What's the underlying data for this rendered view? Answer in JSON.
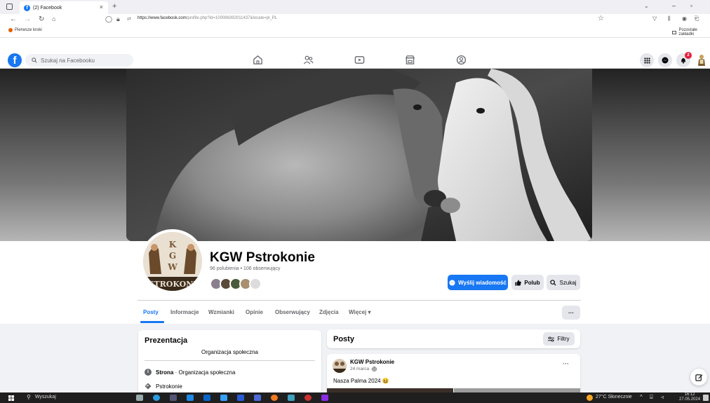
{
  "browser": {
    "tab_title": "(2) Facebook",
    "url_host": "https://www.facebook.com",
    "url_path": "/profile.php?id=100086392011437&locale=pl_PL",
    "bookmark_left": "Pierwsze kroki",
    "bookmark_right": "Pozostałe zakładki"
  },
  "fb": {
    "logo": "f",
    "search_placeholder": "Szukaj na Facebooku",
    "notification_count": "2"
  },
  "profile": {
    "name": "KGW Pstrokonie",
    "stats": "96 polubienia • 106 obserwujący",
    "buttons": {
      "message": "Wyślij wiadomość",
      "like": "Polub",
      "search": "Szukaj",
      "more": "···"
    },
    "tabs": [
      "Posty",
      "Informacje",
      "Wzmianki",
      "Opinie",
      "Obserwujący",
      "Zdjęcia",
      "Więcej ▾"
    ]
  },
  "intro": {
    "title": "Prezentacja",
    "category": "Organizacja społeczna",
    "page_type_bold": "Strona",
    "page_type_rest": " · Organizacja społeczna",
    "location": "Pstrokonie"
  },
  "posts": {
    "title": "Posty",
    "filter_label": "Filtry",
    "post": {
      "author": "KGW Pstrokonie",
      "date": "24 marca · ",
      "text": "Nasza Palma 2024 😆",
      "menu": "···"
    }
  },
  "taskbar": {
    "search": "Wyszukaj",
    "weather": "27°C  Słonecznie",
    "time": "16:12",
    "date": "27.05.2024"
  },
  "colors": {
    "fb_blue": "#1877f2",
    "page_bg": "#f0f2f5",
    "badge_red": "#e41e3f"
  },
  "icons": [
    "home-icon",
    "friends-icon",
    "watch-icon",
    "marketplace-icon",
    "groups-icon",
    "menu-grid-icon",
    "messenger-icon",
    "bell-icon",
    "edit-icon"
  ]
}
